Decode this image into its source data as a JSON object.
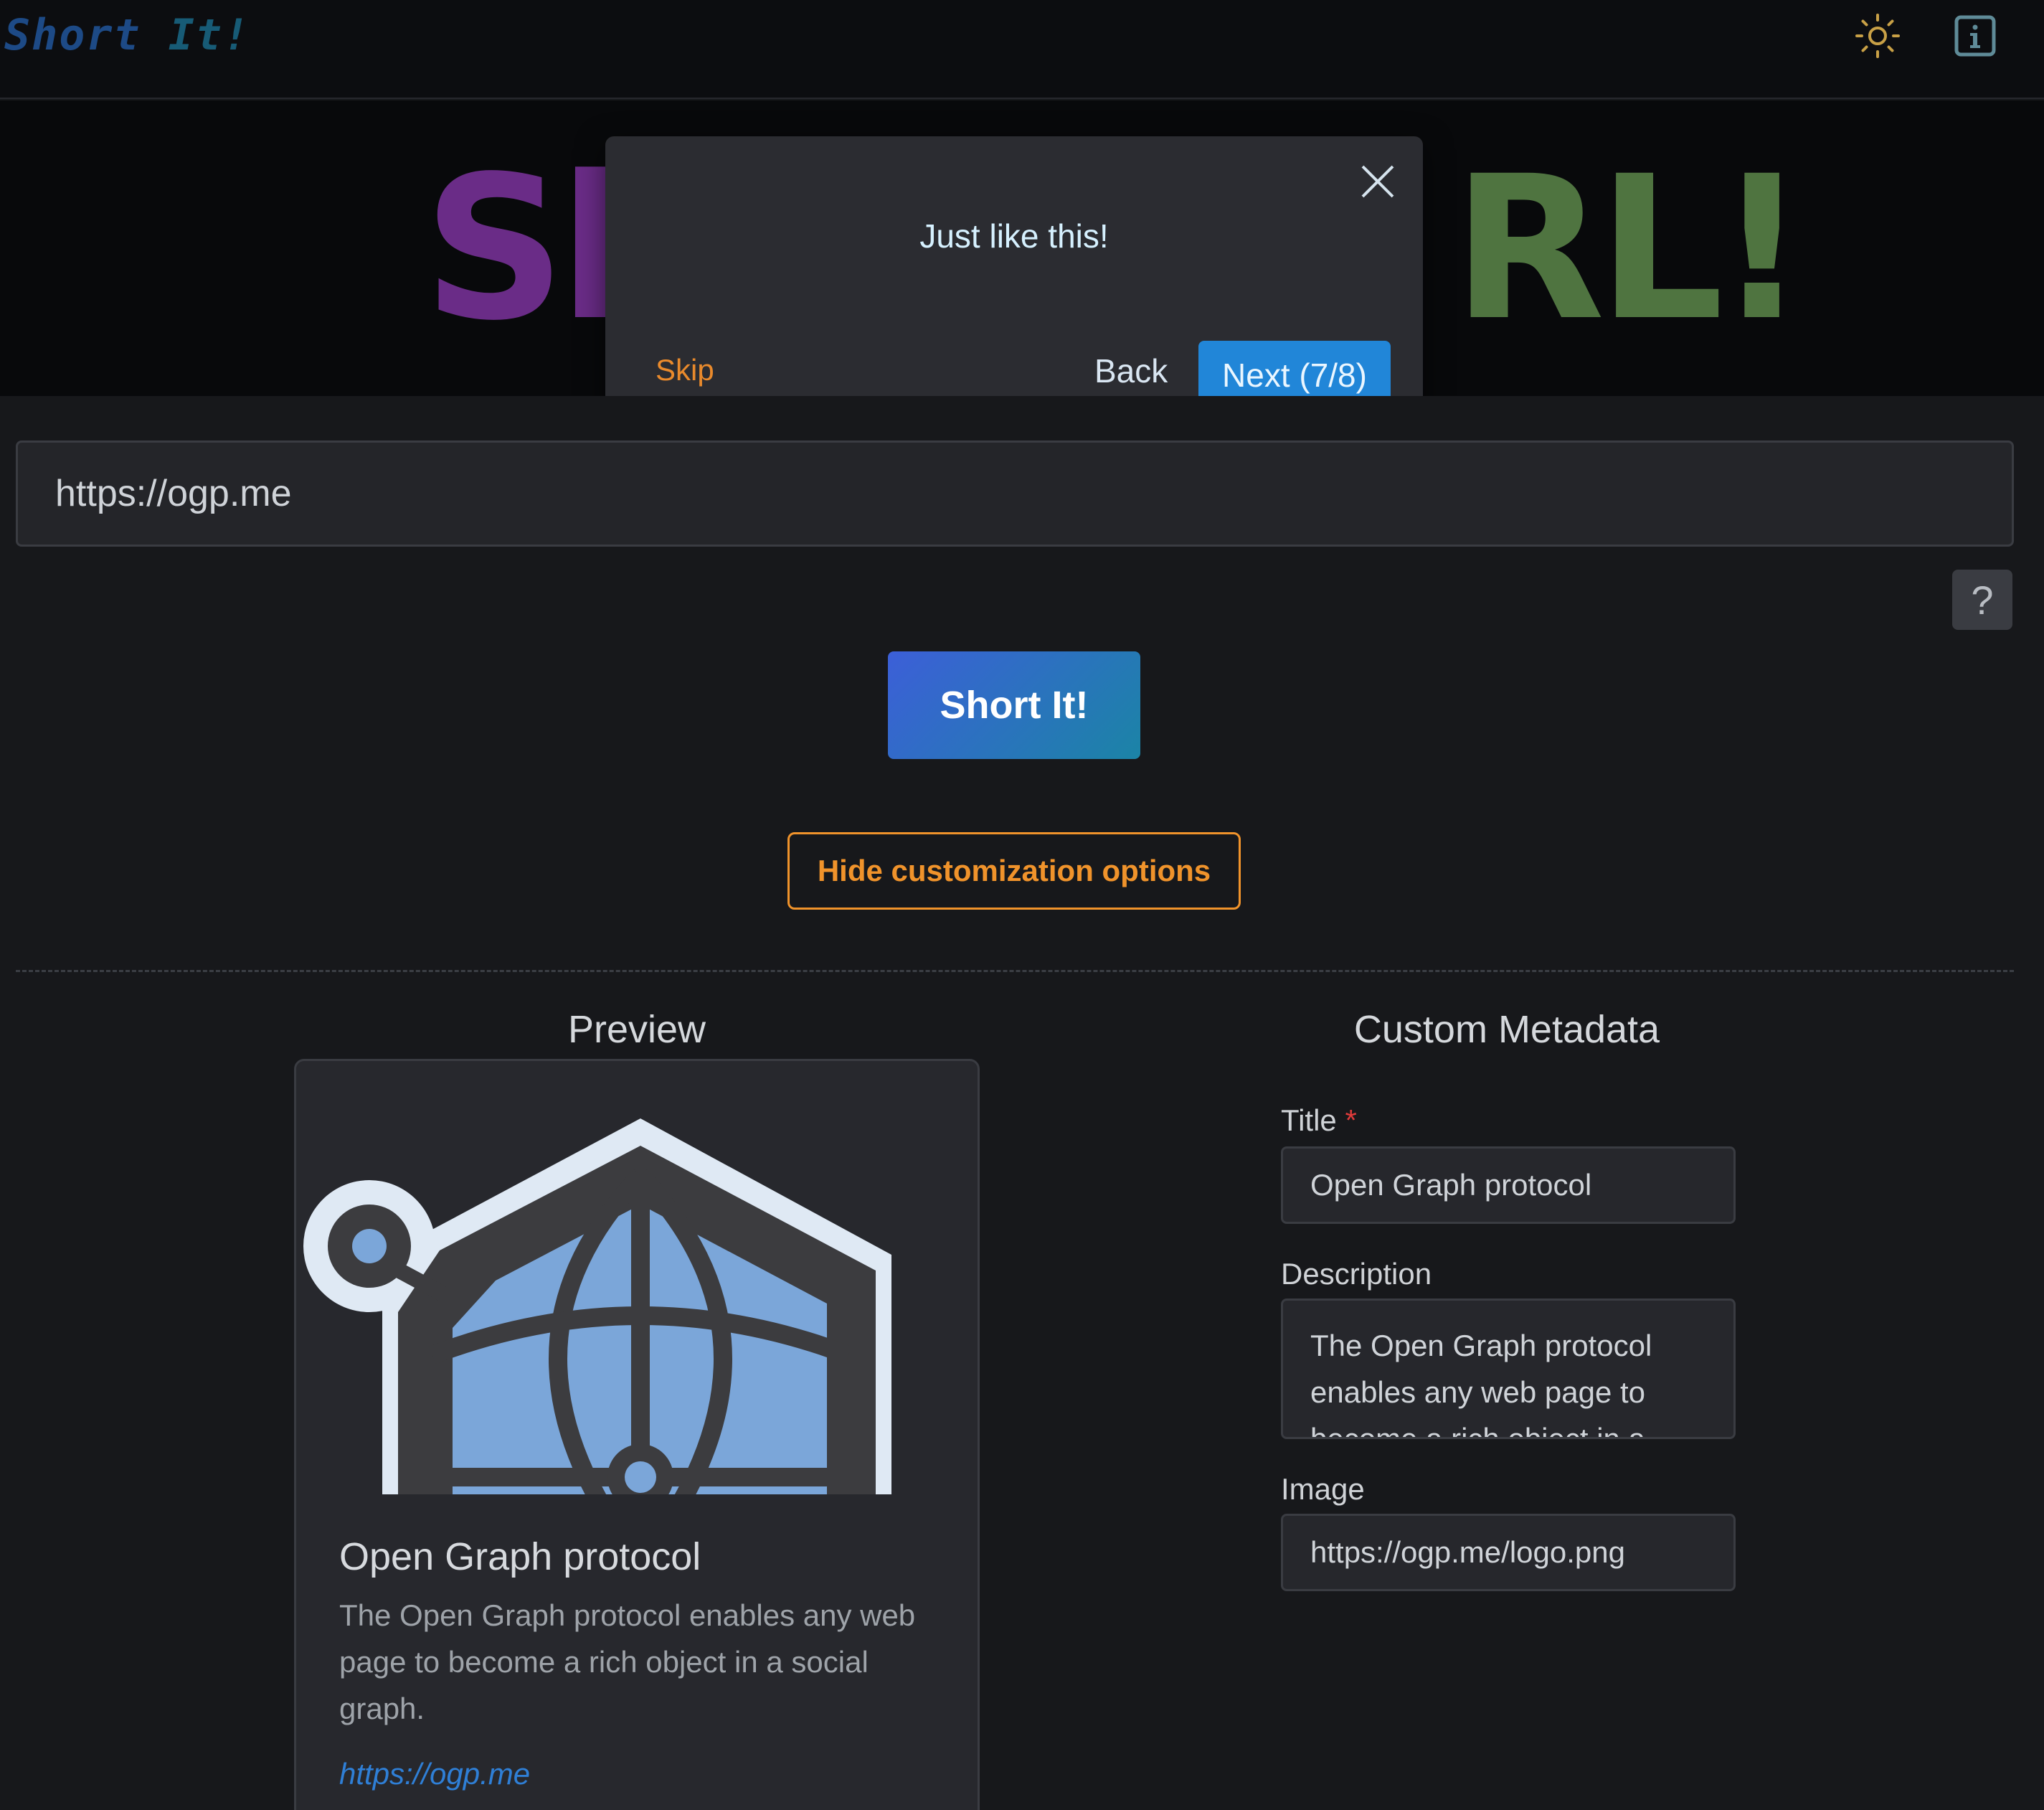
{
  "nav": {
    "brand_word1": "Short",
    "brand_word2": "It!",
    "theme_icon": "sun-icon",
    "info_icon": "info-icon"
  },
  "hero": {
    "title_visible_left": "Sh",
    "title_visible_right": "RL!"
  },
  "tour": {
    "title": "Just like this!",
    "skip_label": "Skip",
    "back_label": "Back",
    "next_label": "Next (7/8)",
    "close_icon": "close-icon"
  },
  "url_input": {
    "value": "https://ogp.me"
  },
  "help_button": {
    "label": "?"
  },
  "short_button": {
    "label": "Short It!"
  },
  "customize_button": {
    "label": "Hide customization options"
  },
  "preview": {
    "heading": "Preview",
    "card": {
      "title": "Open Graph protocol",
      "description": "The Open Graph protocol enables any web page to become a rich object in a social graph.",
      "link": "https://ogp.me"
    }
  },
  "metadata": {
    "heading": "Custom Metadata",
    "title_label": "Title",
    "required_mark": "*",
    "title_value": "Open Graph protocol",
    "description_label": "Description",
    "description_value": "The Open Graph protocol enables any web page to become a rich object in a social graph.",
    "image_label": "Image",
    "image_value": "https://ogp.me/logo.png"
  },
  "colors": {
    "accent_blue": "#2186d8",
    "accent_orange": "#f0932b",
    "background": "#17181b"
  }
}
